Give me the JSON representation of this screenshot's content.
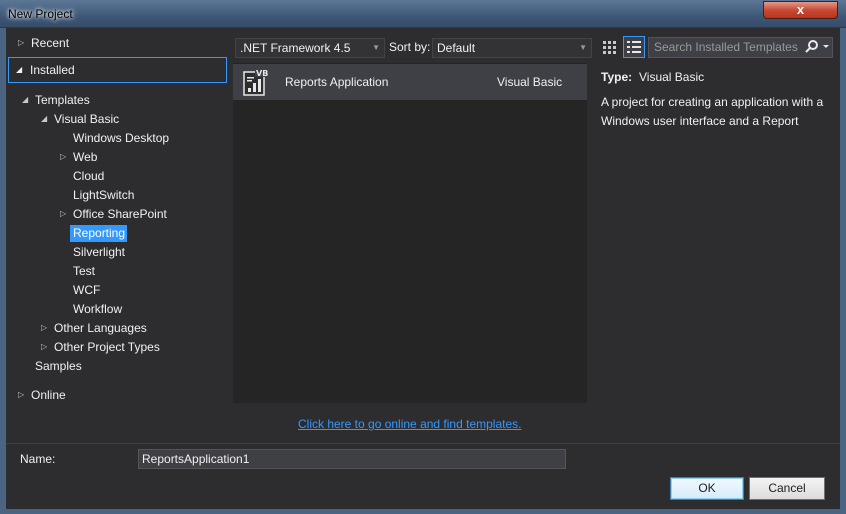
{
  "window": {
    "title": "New Project",
    "close_glyph": "x"
  },
  "tree": {
    "recent": "Recent",
    "installed": "Installed",
    "templates": "Templates",
    "visual_basic": "Visual Basic",
    "children": [
      "Windows Desktop",
      "Web",
      "Cloud",
      "LightSwitch",
      "Office SharePoint",
      "Reporting",
      "Silverlight",
      "Test",
      "WCF",
      "Workflow"
    ],
    "other_languages": "Other Languages",
    "other_project_types": "Other Project Types",
    "samples": "Samples",
    "online": "Online",
    "selected": "Reporting"
  },
  "toolbar": {
    "framework": ".NET Framework 4.5",
    "sort_label": "Sort by:",
    "sort_value": "Default",
    "search_placeholder": "Search Installed Templates (Ctrl+E)"
  },
  "templates": [
    {
      "name": "Reports Application",
      "language": "Visual Basic",
      "icon": "vb-report-icon",
      "icon_badge": "VB"
    }
  ],
  "info": {
    "type_label": "Type:",
    "type_value": "Visual Basic",
    "description": "A project for creating an application with a Windows user interface and a Report"
  },
  "online_link": "Click here to go online and find templates.",
  "form": {
    "name_label": "Name:",
    "name_value": "ReportsApplication1"
  },
  "buttons": {
    "ok": "OK",
    "cancel": "Cancel"
  },
  "colors": {
    "accent": "#3399ff",
    "background": "#2d2d30"
  }
}
